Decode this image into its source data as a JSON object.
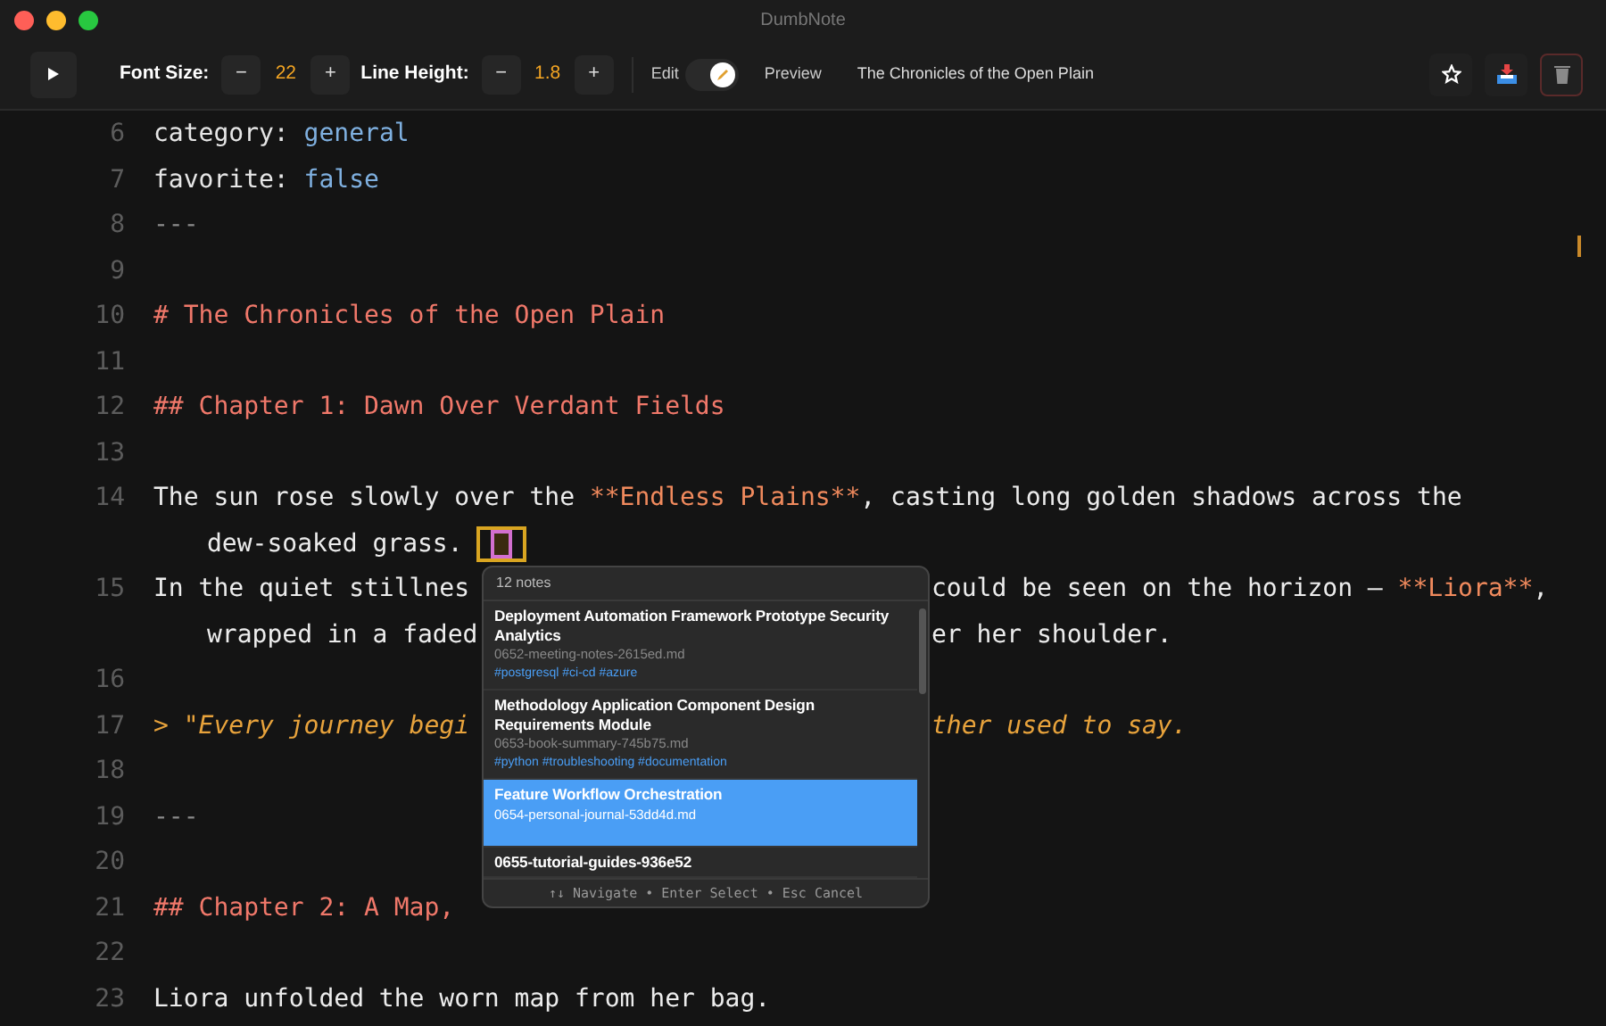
{
  "window": {
    "title": "DumbNote"
  },
  "toolbar": {
    "font_size": {
      "label": "Font Size:",
      "minus": "−",
      "value": "22",
      "plus": "+"
    },
    "line_height": {
      "label": "Line Height:",
      "minus": "−",
      "value": "1.8",
      "plus": "+"
    },
    "edit": {
      "label": "Edit",
      "on": true
    },
    "preview": {
      "label": "Preview"
    },
    "note_title": "The Chronicles of the Open Plain"
  },
  "editor": {
    "lines": [
      {
        "number": "6",
        "rows": [
          {
            "before": [
              {
                "text": "category: ",
                "kind": "key"
              },
              {
                "text": "general",
                "kind": "value"
              }
            ]
          }
        ]
      },
      {
        "number": "7",
        "rows": [
          {
            "before": [
              {
                "text": "favorite: ",
                "kind": "key"
              },
              {
                "text": "false",
                "kind": "value"
              }
            ]
          }
        ]
      },
      {
        "number": "8",
        "rows": [
          {
            "before": [
              {
                "text": "---",
                "kind": "muted"
              }
            ]
          }
        ]
      },
      {
        "number": "9",
        "rows": [
          {
            "before": []
          }
        ]
      },
      {
        "number": "10",
        "rows": [
          {
            "before": [
              {
                "text": "# The Chronicles of the Open Plain",
                "kind": "heading"
              }
            ]
          }
        ]
      },
      {
        "number": "11",
        "rows": [
          {
            "before": []
          }
        ]
      },
      {
        "number": "12",
        "rows": [
          {
            "before": [
              {
                "text": "## Chapter 1: Dawn Over Verdant Fields",
                "kind": "heading"
              }
            ]
          }
        ]
      },
      {
        "number": "13",
        "rows": [
          {
            "before": []
          }
        ]
      },
      {
        "number": "14",
        "rows": [
          {
            "before": [
              {
                "text": "The sun rose slowly over the ",
                "kind": "plain"
              },
              {
                "text": "**Endless Plains**",
                "kind": "bold"
              },
              {
                "text": ", casting long golden shadows across the",
                "kind": "plain"
              }
            ]
          },
          {
            "before": [
              {
                "text": "dew-soaked grass.",
                "kind": "plain"
              }
            ],
            "cursor_marker": true
          }
        ]
      },
      {
        "number": "15",
        "rows": [
          {
            "before": [
              {
                "text": "In the quiet stillnes",
                "kind": "plain"
              }
            ],
            "after": [
              {
                "text": "could be seen on the horizon — ",
                "kind": "plain"
              },
              {
                "text": "**Liora**",
                "kind": "bold"
              },
              {
                "text": ",",
                "kind": "plain"
              }
            ]
          },
          {
            "before": [
              {
                "text": "wrapped in a faded",
                "kind": "plain"
              }
            ],
            "after": [
              {
                "text": "er her shoulder.",
                "kind": "plain"
              }
            ]
          }
        ]
      },
      {
        "number": "16",
        "rows": [
          {
            "before": []
          }
        ]
      },
      {
        "number": "17",
        "rows": [
          {
            "before": [
              {
                "text": "> \"Every journey begi",
                "kind": "quote"
              }
            ],
            "after": [
              {
                "text": "ther used to say.",
                "kind": "quote"
              }
            ]
          }
        ]
      },
      {
        "number": "18",
        "rows": [
          {
            "before": []
          }
        ]
      },
      {
        "number": "19",
        "rows": [
          {
            "before": [
              {
                "text": "---",
                "kind": "muted"
              }
            ]
          }
        ]
      },
      {
        "number": "20",
        "rows": [
          {
            "before": []
          }
        ]
      },
      {
        "number": "21",
        "rows": [
          {
            "before": [
              {
                "text": "## Chapter 2: A Map,",
                "kind": "heading"
              }
            ]
          }
        ]
      },
      {
        "number": "22",
        "rows": [
          {
            "before": []
          }
        ]
      },
      {
        "number": "23",
        "rows": [
          {
            "before": [
              {
                "text": "Liora unfolded the worn map from her bag.",
                "kind": "plain"
              }
            ]
          }
        ]
      }
    ]
  },
  "popup": {
    "count": "12 notes",
    "items": [
      {
        "title": "Deployment Automation Framework Prototype Security Analytics",
        "file": "0652-meeting-notes-2615ed.md",
        "tags": "#postgresql #ci-cd #azure",
        "selected": false
      },
      {
        "title": "Methodology Application Component Design Requirements Module",
        "file": "0653-book-summary-745b75.md",
        "tags": "#python #troubleshooting #documentation",
        "selected": false
      },
      {
        "title": "Feature Workflow Orchestration",
        "file": "0654-personal-journal-53dd4d.md",
        "selected": true
      },
      {
        "title": "0655-tutorial-guides-936e52",
        "selected": false
      }
    ],
    "footer": "↑↓ Navigate • Enter Select • Esc Cancel"
  }
}
